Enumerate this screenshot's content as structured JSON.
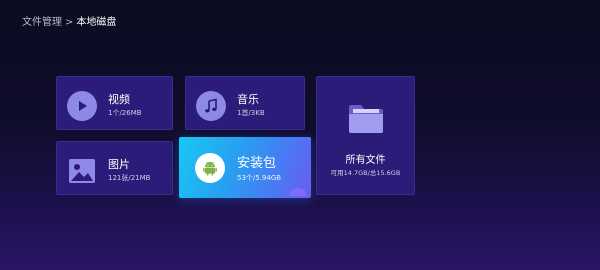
{
  "breadcrumb": {
    "parent": "文件管理",
    "separator": ">",
    "current": "本地磁盘"
  },
  "tiles": {
    "video": {
      "label": "视频",
      "sub": "1个/26MB",
      "icon": "play-icon"
    },
    "music": {
      "label": "音乐",
      "sub": "1首/3KB",
      "icon": "music-note-icon"
    },
    "image": {
      "label": "图片",
      "sub": "121张/21MB",
      "icon": "image-icon"
    },
    "apk": {
      "label": "安装包",
      "sub": "53个/5.94GB",
      "icon": "android-icon",
      "focused": true
    },
    "all": {
      "label": "所有文件",
      "sub": "可用14.7GB/总15.6GB",
      "icon": "folder-icon"
    }
  },
  "colors": {
    "tile_bg": "#2a1c78",
    "icon_circle": "#8e88e6",
    "focus_gradient_start": "#18c8f2",
    "focus_gradient_end": "#6a5cf0",
    "android_green": "#7cb342"
  }
}
